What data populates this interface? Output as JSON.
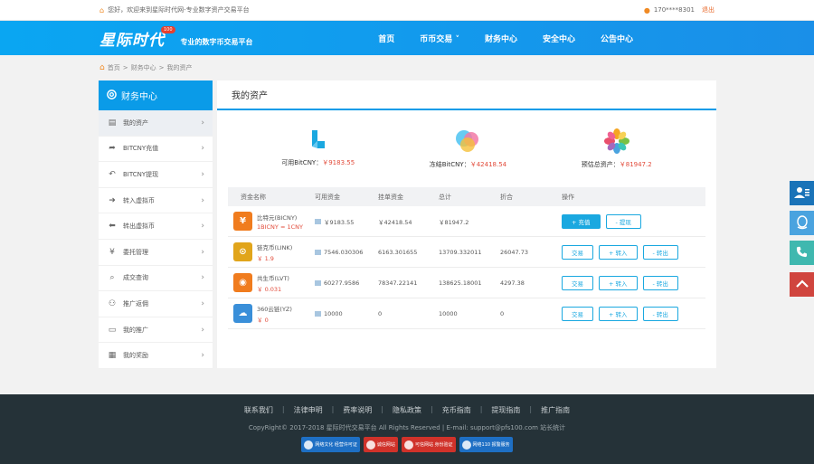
{
  "topbar": {
    "welcome": "您好，欢迎来到星际时代网-专业数字资产交易平台",
    "phone": "170****8301",
    "logout": "退出"
  },
  "header": {
    "logo": "星际时代",
    "badge": "100",
    "slogan": "专业的数字币交易平台",
    "nav": [
      "首页",
      "币币交易",
      "财务中心",
      "安全中心",
      "公告中心"
    ]
  },
  "breadcrumb": [
    "首页",
    "财务中心",
    "我的资产"
  ],
  "sidebar": {
    "title": "财务中心",
    "items": [
      {
        "label": "我的资产",
        "icon": "wallet-icon"
      },
      {
        "label": "BITCNY充值",
        "icon": "share-icon"
      },
      {
        "label": "BITCNY提现",
        "icon": "reply-icon"
      },
      {
        "label": "转入虚拟币",
        "icon": "arrow-right-icon"
      },
      {
        "label": "转出虚拟币",
        "icon": "arrow-left-icon"
      },
      {
        "label": "委托管理",
        "icon": "yen-icon"
      },
      {
        "label": "成交查询",
        "icon": "search-icon"
      },
      {
        "label": "推广返佣",
        "icon": "users-icon"
      },
      {
        "label": "我的推广",
        "icon": "card-icon"
      },
      {
        "label": "我的奖励",
        "icon": "archive-icon"
      }
    ]
  },
  "main": {
    "title": "我的资产",
    "summary": [
      {
        "label": "可用BitCNY：",
        "value": "￥9183.55",
        "icon": "bitcny-icon"
      },
      {
        "label": "冻结BitCNY：",
        "value": "￥42418.54",
        "icon": "bubbles-icon"
      },
      {
        "label": "预估总资产：",
        "value": "￥81947.2",
        "icon": "flower-icon"
      }
    ],
    "columns": [
      "资金名称",
      "可用资金",
      "挂单资金",
      "总计",
      "折合",
      "操作"
    ],
    "rows": [
      {
        "name": "比特元(BICNY)",
        "price": "1BICNY = 1CNY",
        "available": "￥9183.55",
        "frozen": "￥42418.54",
        "total": "￥81947.2",
        "equiv": "",
        "color": "#f07c1e",
        "glyph": "¥",
        "actions": [
          "+ 充值",
          "- 提现"
        ]
      },
      {
        "name": "链克币(LINK)",
        "price": "￥ 1.9",
        "available": "7546.030306",
        "frozen": "6163.301655",
        "total": "13709.332011",
        "equiv": "26047.73",
        "color": "#e1a51b",
        "glyph": "⊙",
        "actions": [
          "交易",
          "+ 转入",
          "- 转出"
        ]
      },
      {
        "name": "共生币(LVT)",
        "price": "￥ 0.031",
        "available": "60277.9586",
        "frozen": "78347.22141",
        "total": "138625.18001",
        "equiv": "4297.38",
        "color": "#f07c1e",
        "glyph": "◉",
        "actions": [
          "交易",
          "+ 转入",
          "- 转出"
        ]
      },
      {
        "name": "360云链(YZ)",
        "price": "￥ 0",
        "available": "10000",
        "frozen": "0",
        "total": "10000",
        "equiv": "0",
        "color": "#3a8fd9",
        "glyph": "☁",
        "actions": [
          "交易",
          "+ 转入",
          "- 转出"
        ]
      }
    ]
  },
  "footer": {
    "links": [
      "联系我们",
      "法律申明",
      "费率说明",
      "隐私政策",
      "充币指南",
      "提现指南",
      "推广指南"
    ],
    "copyright": "CopyRight© 2017-2018 星际时代交易平台 All Rights Reserved | E-mail: support@pfs100.com 站长统计",
    "badges": [
      {
        "label": "网络文化 经营许可证",
        "color": "#1e6fc4"
      },
      {
        "label": "诚信网站",
        "color": "#d0322a"
      },
      {
        "label": "可信网站 身份验证",
        "color": "#d0322a"
      },
      {
        "label": "网络110 报警服务",
        "color": "#1e6fc4"
      }
    ]
  }
}
